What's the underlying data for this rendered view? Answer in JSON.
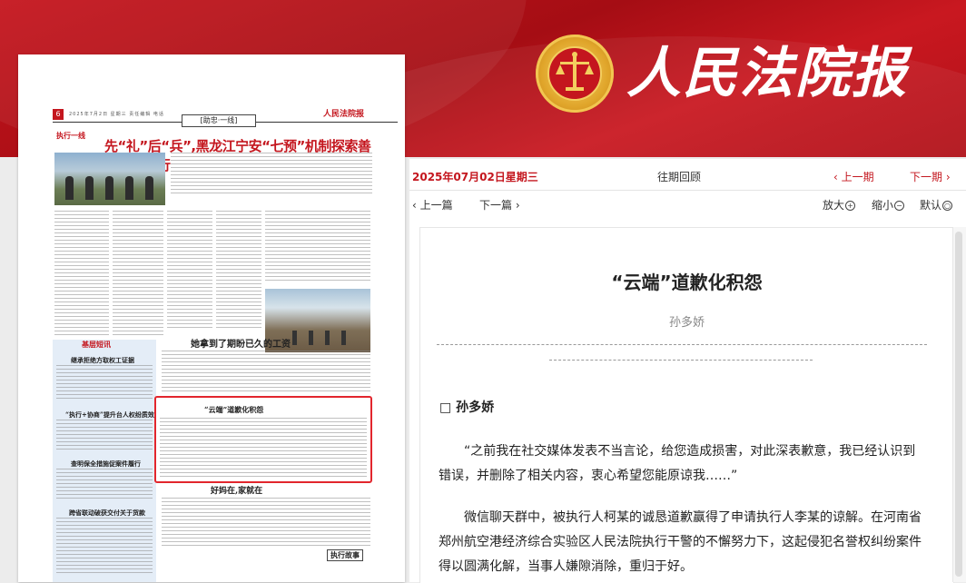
{
  "masthead": {
    "title": "人民法院报"
  },
  "paper_page": {
    "page_no": "6",
    "header_tiny": "2025年7月2日  星期三  责任编辑  电话",
    "brand": "人民法院报",
    "section": "[助忠·一线]",
    "column_tag": "执行一线",
    "headline_main": "先“礼”后“兵”,黑龙江宁安“七预”机制探索善意文明执行",
    "sidebar_title": "基层短讯",
    "sub_heads": [
      "继承拒绝方取权工证据",
      "“执行+协商”提升台人权纷质效",
      "查明保全措施促案件履行",
      "跨省联动破获交付关于货款"
    ],
    "headline_wage": "她拿到了期盼已久的工资",
    "headline_cloud": "“云端”道歉化积怨",
    "headline_family": "好妈在,家就在",
    "story_tag": "执行故事"
  },
  "issue": {
    "date": "2025年07月02日星期三",
    "back_issue": "往期回顾",
    "prev_issue": "‹ 上一期",
    "next_issue": "下一期 ›"
  },
  "toolbar": {
    "prev_article": "‹ 上一篇",
    "next_article": "下一篇 ›",
    "zoom_in": "放大",
    "zoom_out": "缩小",
    "zoom_reset": "默认",
    "zoom_in_glyph": "+",
    "zoom_out_glyph": "−",
    "zoom_reset_glyph": "○"
  },
  "article": {
    "title": "“云端”道歉化积怨",
    "author": "孙多娇",
    "byline": "□ 孙多娇",
    "paragraphs": [
      "“之前我在社交媒体发表不当言论，给您造成损害，对此深表歉意，我已经认识到错误，并删除了相关内容，衷心希望您能原谅我……”",
      "微信聊天群中，被执行人柯某的诚恳道歉赢得了申请执行人李某的谅解。在河南省郑州航空港经济综合实验区人民法院执行干警的不懈努力下，这起侵犯名誉权纠纷案件得以圆满化解，当事人嫌隙消除，重归于好。"
    ]
  },
  "colors": {
    "accent": "#c4161e",
    "highlight_box": "#e2262d"
  }
}
